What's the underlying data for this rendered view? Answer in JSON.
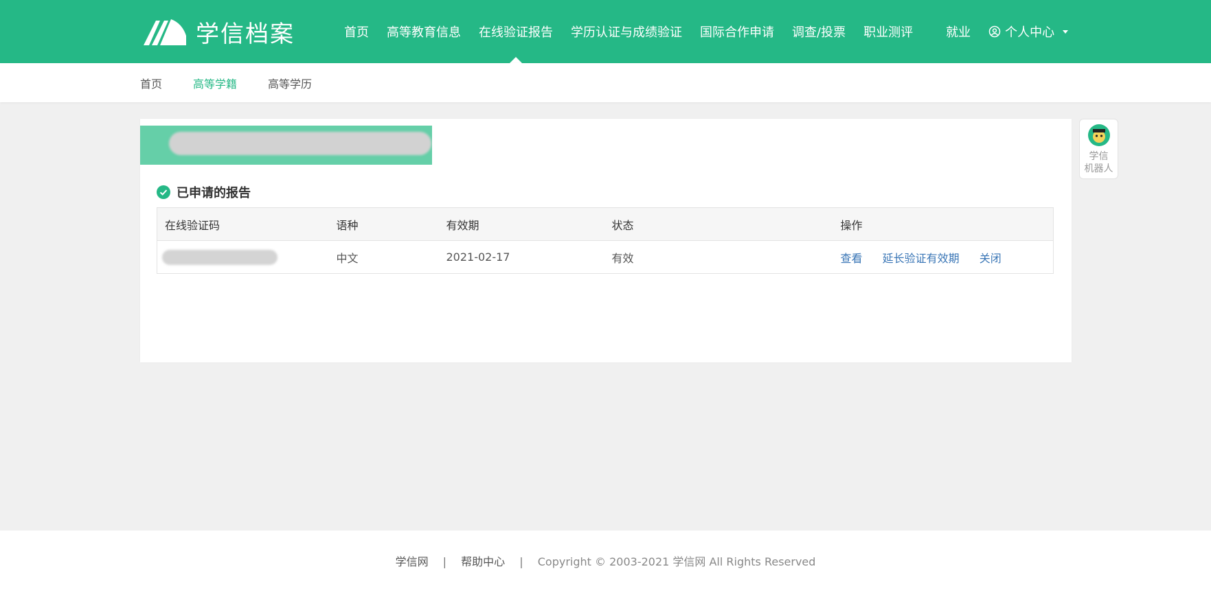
{
  "header": {
    "logo_text": "学信档案",
    "nav": [
      "首页",
      "高等教育信息",
      "在线验证报告",
      "学历认证与成绩验证",
      "国际合作申请",
      "调查/投票",
      "职业测评"
    ],
    "nav_employment": "就业",
    "user_menu": "个人中心"
  },
  "subnav": {
    "items": [
      "首页",
      "高等学籍",
      "高等学历"
    ],
    "active_index": 1
  },
  "main": {
    "section_title": "已申请的报告",
    "table": {
      "headers": [
        "在线验证码",
        "语种",
        "有效期",
        "状态",
        "操作"
      ],
      "rows": [
        {
          "code": "",
          "language": "中文",
          "expiry": "2021-02-17",
          "status": "有效",
          "actions": [
            "查看",
            "延长验证有效期",
            "关闭"
          ]
        }
      ]
    }
  },
  "robot": {
    "label_line1": "学信",
    "label_line2": "机器人"
  },
  "footer": {
    "link1": "学信网",
    "sep": "|",
    "link2": "帮助中心",
    "copyright": "Copyright © 2003-2021 学信网 All Rights Reserved"
  },
  "colors": {
    "brand": "#25b886",
    "link": "#3a76b6",
    "background": "#f0f0f0"
  },
  "icons": [
    "logo-mark-icon",
    "user-circle-icon",
    "chevron-down-icon",
    "check-circle-icon",
    "robot-avatar-icon"
  ]
}
